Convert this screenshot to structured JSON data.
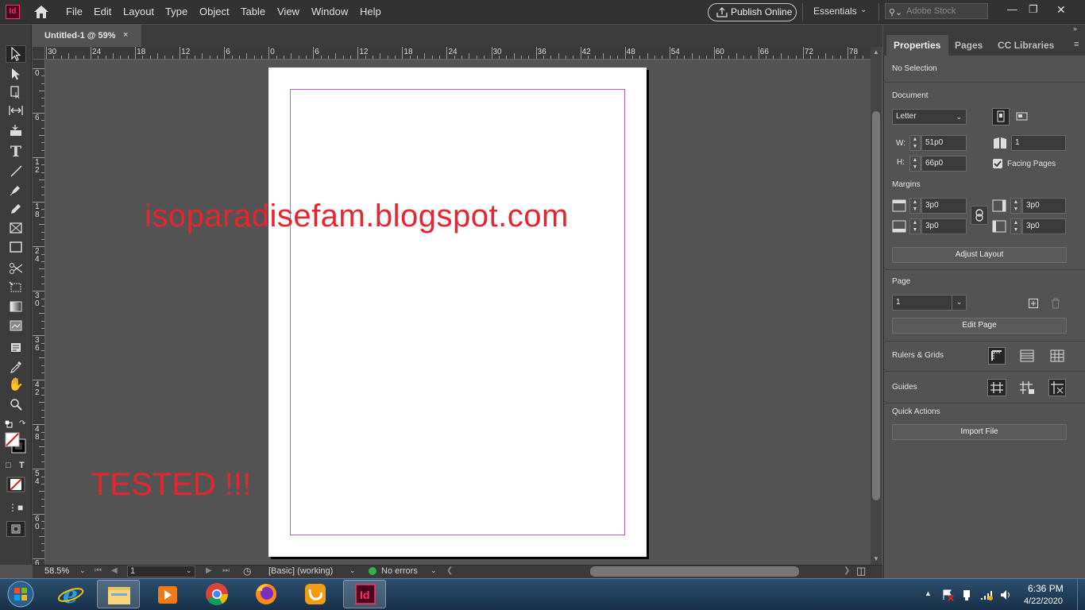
{
  "app": {
    "logo_text": "Id"
  },
  "menu": [
    "File",
    "Edit",
    "Layout",
    "Type",
    "Object",
    "Table",
    "View",
    "Window",
    "Help"
  ],
  "header": {
    "publish_label": "Publish Online",
    "workspace": "Essentials",
    "stock_placeholder": "Adobe Stock"
  },
  "document_tab": {
    "title": "Untitled-1 @ 59%",
    "close": "×"
  },
  "rulers": {
    "horizontal": [
      "30",
      "24",
      "18",
      "12",
      "6",
      "0",
      "6",
      "12",
      "18",
      "24",
      "30",
      "36",
      "42",
      "48",
      "54",
      "60",
      "66",
      "72",
      "78"
    ],
    "vertical": [
      "0",
      "6",
      "12",
      "18",
      "24",
      "30",
      "36",
      "42",
      "48",
      "54",
      "60",
      "6"
    ]
  },
  "canvas": {
    "watermark": "isoparadisefam.blogspot.com",
    "tested": "TESTED !!!"
  },
  "status": {
    "zoom": "58.5%",
    "page": "1",
    "profile": "[Basic] (working)",
    "errors": "No errors"
  },
  "panel": {
    "tabs": [
      "Properties",
      "Pages",
      "CC Libraries"
    ],
    "selection": "No Selection",
    "document_label": "Document",
    "preset": "Letter",
    "w_label": "W:",
    "width": "51p0",
    "h_label": "H:",
    "height": "66p0",
    "pages_count": "1",
    "facing_pages": "Facing Pages",
    "facing_pages_checked": true,
    "margins_label": "Margins",
    "margin_top": "3p0",
    "margin_bottom": "3p0",
    "margin_inside": "3p0",
    "margin_outside": "3p0",
    "adjust_layout": "Adjust Layout",
    "page_label": "Page",
    "page_value": "1",
    "edit_page": "Edit Page",
    "rulers_grids": "Rulers & Grids",
    "guides": "Guides",
    "quick_actions": "Quick Actions",
    "import_file": "Import File"
  },
  "taskbar": {
    "time": "6:36 PM",
    "date": "4/22/2020",
    "indesign_label": "Id"
  },
  "colors": {
    "margin_guide": "#c55ad9",
    "watermark": "#e8242e",
    "indesign_brand": "#ff3366"
  }
}
